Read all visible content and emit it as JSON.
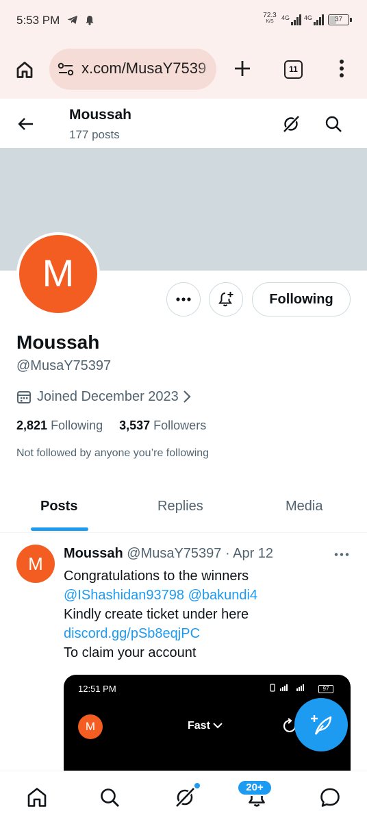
{
  "status_bar": {
    "time": "5:53 PM",
    "net_speed_value": "72.3",
    "net_speed_unit": "K/S",
    "signal1_label": "4G",
    "signal2_label": "4G",
    "battery": "37",
    "icons": [
      "telegram-icon",
      "notification-bell-icon",
      "signal-icon",
      "battery-icon"
    ]
  },
  "browser": {
    "url": "x.com/MusaY7539",
    "tab_count": "11",
    "icons": [
      "home-icon",
      "site-settings-icon",
      "new-tab-plus-icon",
      "tab-switcher-icon",
      "overflow-menu-icon"
    ]
  },
  "header": {
    "name": "Moussah",
    "post_count": "177 posts",
    "icons": [
      "back-arrow-icon",
      "grok-icon",
      "search-icon"
    ]
  },
  "profile": {
    "avatar_letter": "M",
    "display_name": "Moussah",
    "handle": "@MusaY75397",
    "joined": "Joined December 2023",
    "following_count": "2,821",
    "following_label": "Following",
    "followers_count": "3,537",
    "followers_label": "Followers",
    "not_followed_text": "Not followed by anyone you’re following",
    "following_button": "Following"
  },
  "tabs": [
    {
      "label": "Posts",
      "active": true
    },
    {
      "label": "Replies",
      "active": false
    },
    {
      "label": "Media",
      "active": false
    }
  ],
  "post": {
    "avatar_letter": "M",
    "author": "Moussah",
    "handle": "@MusaY75397",
    "separator": "·",
    "date": "Apr 12",
    "line1": "Congratulations to the winners",
    "mention1": "@IShashidan93798",
    "mention2": "@bakundi4",
    "line3": "Kindly create ticket under here",
    "link": "discord.gg/pSb8eqjPC",
    "line5": "To claim your account",
    "media": {
      "time": "12:51 PM",
      "battery": "97",
      "avatar_letter": "M",
      "mode_label": "Fast"
    }
  },
  "bottom_nav": {
    "notification_badge": "20+",
    "items": [
      "home-icon",
      "search-icon",
      "grok-icon",
      "notifications-icon",
      "messages-icon"
    ]
  },
  "colors": {
    "accent": "#1d9bf0",
    "avatar": "#f45d22",
    "banner": "#cfd9de",
    "browser_bg": "#fcf0ee",
    "url_bar_bg": "#f6dcd6",
    "secondary_text": "#536471"
  }
}
